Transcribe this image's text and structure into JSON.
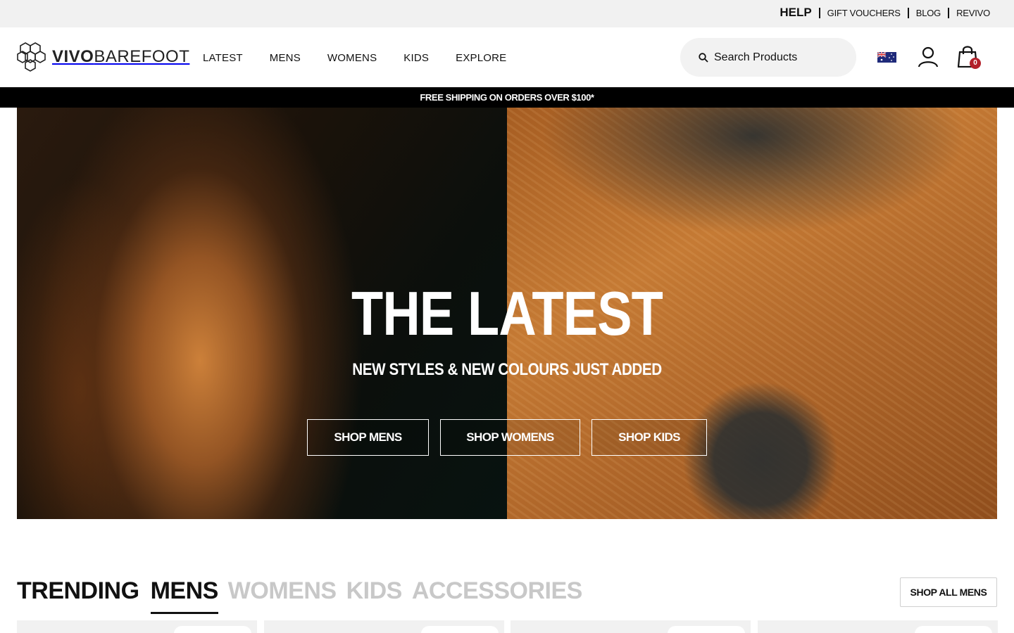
{
  "utility_bar": {
    "links": [
      "HELP",
      "GIFT VOUCHERS",
      "BLOG",
      "REVIVO"
    ]
  },
  "header": {
    "logo": {
      "bold": "VIVO",
      "light": "BAREFOOT"
    },
    "nav": [
      "LATEST",
      "MENS",
      "WOMENS",
      "KIDS",
      "EXPLORE"
    ],
    "search": {
      "placeholder": "Search Products",
      "value": ""
    },
    "cart_count": "0",
    "icons": {
      "search": "search-icon",
      "flag": "australia-flag-icon",
      "account": "user-icon",
      "cart": "shopping-bag-icon"
    }
  },
  "promo": {
    "text": "FREE SHIPPING ON ORDERS OVER $100*"
  },
  "hero": {
    "title": "THE LATEST",
    "subtitle": "NEW STYLES & NEW COLOURS JUST ADDED",
    "buttons": [
      "SHOP MENS",
      "SHOP WOMENS",
      "SHOP KIDS"
    ]
  },
  "trending": {
    "label": "TRENDING",
    "tabs": [
      "MENS",
      "WOMENS",
      "KIDS",
      "ACCESSORIES"
    ],
    "active_tab": "MENS",
    "shop_all": "SHOP ALL MENS"
  },
  "colors": {
    "promo_bg": "#000000",
    "utility_bg": "#f1f1f1",
    "cart_badge": "#b3202a",
    "inactive_tab": "#c8c8c8"
  }
}
